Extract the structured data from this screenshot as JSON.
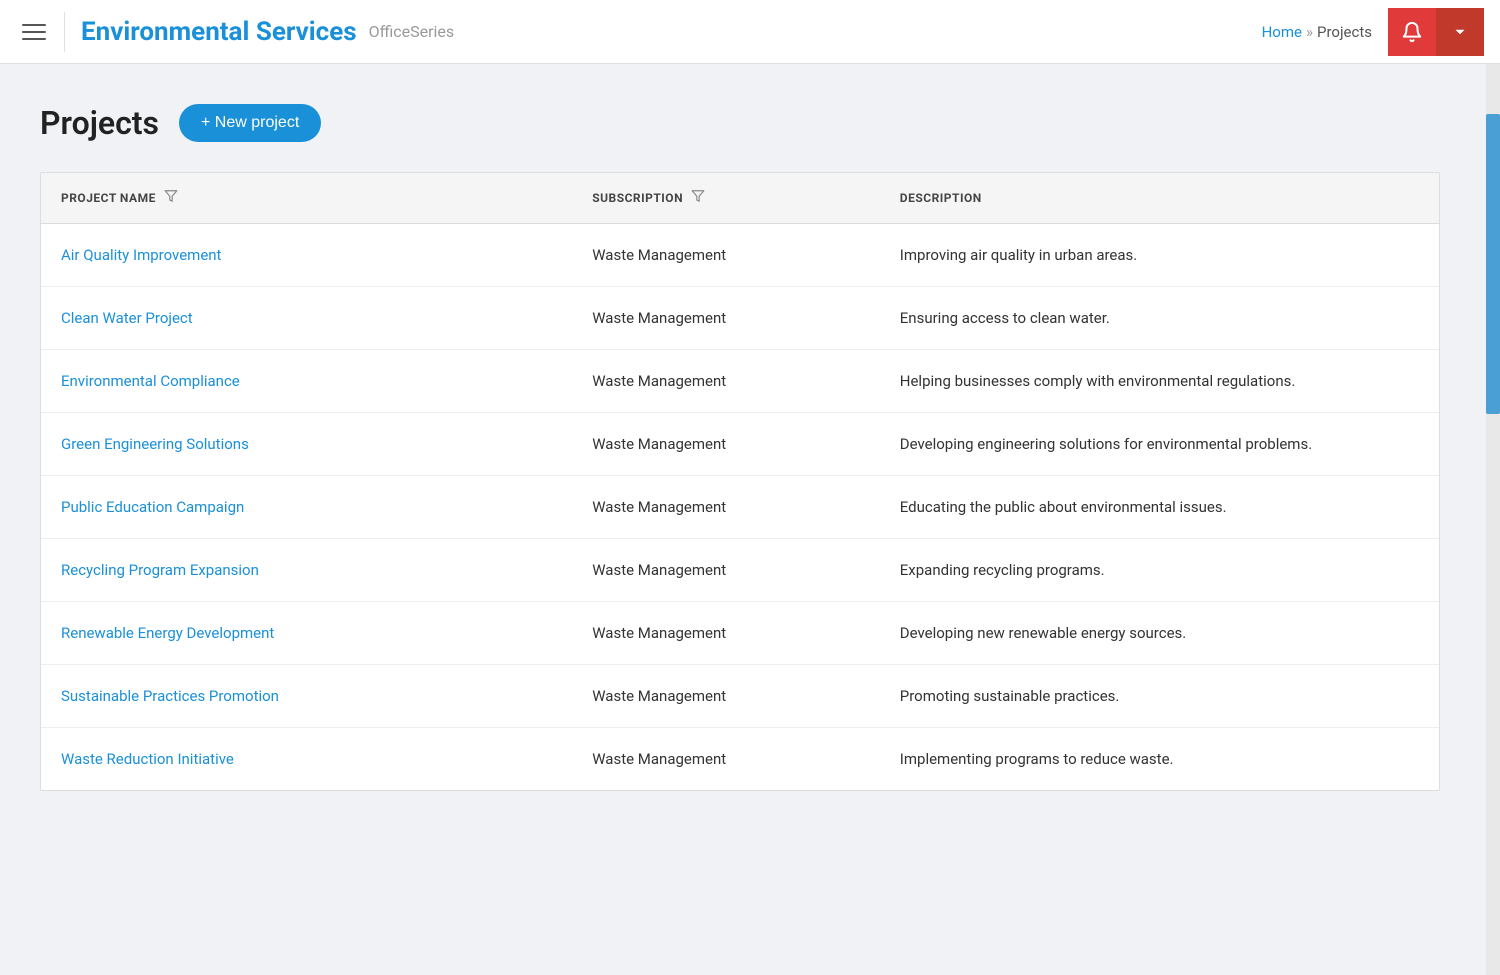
{
  "header": {
    "title": "Environmental Services",
    "subtitle": "OfficeSeries",
    "breadcrumb": {
      "home": "Home",
      "separator": "»",
      "current": "Projects"
    }
  },
  "page": {
    "title": "Projects",
    "new_project_label": "+ New project"
  },
  "table": {
    "columns": [
      {
        "key": "name",
        "label": "PROJECT NAME"
      },
      {
        "key": "subscription",
        "label": "SUBSCRIPTION"
      },
      {
        "key": "description",
        "label": "DESCRIPTION"
      }
    ],
    "rows": [
      {
        "name": "Air Quality Improvement",
        "subscription": "Waste Management",
        "description": "Improving air quality in urban areas."
      },
      {
        "name": "Clean Water Project",
        "subscription": "Waste Management",
        "description": "Ensuring access to clean water."
      },
      {
        "name": "Environmental Compliance",
        "subscription": "Waste Management",
        "description": "Helping businesses comply with environmental regulations."
      },
      {
        "name": "Green Engineering Solutions",
        "subscription": "Waste Management",
        "description": "Developing engineering solutions for environmental problems."
      },
      {
        "name": "Public Education Campaign",
        "subscription": "Waste Management",
        "description": "Educating the public about environmental issues."
      },
      {
        "name": "Recycling Program Expansion",
        "subscription": "Waste Management",
        "description": "Expanding recycling programs."
      },
      {
        "name": "Renewable Energy Development",
        "subscription": "Waste Management",
        "description": "Developing new renewable energy sources."
      },
      {
        "name": "Sustainable Practices Promotion",
        "subscription": "Waste Management",
        "description": "Promoting sustainable practices."
      },
      {
        "name": "Waste Reduction Initiative",
        "subscription": "Waste Management",
        "description": "Implementing programs to reduce waste."
      }
    ]
  }
}
